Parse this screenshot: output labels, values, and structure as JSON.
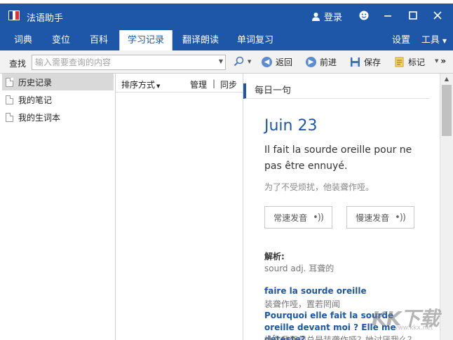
{
  "app": {
    "title": "法语助手",
    "user_label": "登录",
    "logo_colors": [
      "#1e3f9a",
      "#ffffff",
      "#e8312f"
    ]
  },
  "window_controls": {
    "smiley_icon": "smiley-icon",
    "minimize_icon": "minimize-icon",
    "maximize_icon": "maximize-icon",
    "close_icon": "close-icon"
  },
  "nav": {
    "tabs": [
      {
        "label": "词典",
        "active": false
      },
      {
        "label": "变位",
        "active": false
      },
      {
        "label": "百科",
        "active": false
      },
      {
        "label": "学习记录",
        "active": true
      },
      {
        "label": "翻译朗读",
        "active": false
      },
      {
        "label": "单词复习",
        "active": false
      }
    ],
    "settings_label": "设置",
    "tools_label": "工具"
  },
  "toolbar": {
    "search_label": "查找",
    "search_placeholder": "输入需要查询的内容",
    "back_label": "返回",
    "forward_label": "前进",
    "save_label": "保存",
    "bookmark_label": "标记"
  },
  "sidebar": {
    "items": [
      {
        "label": "历史记录",
        "selected": true
      },
      {
        "label": "我的笔记",
        "selected": false
      },
      {
        "label": "我的生词本",
        "selected": false
      }
    ]
  },
  "list_header": {
    "sort_label": "排序方式",
    "manage_label": "管理",
    "separator": "|",
    "sync_label": "同步"
  },
  "daily": {
    "header": "每日一句",
    "date": "Juin 23",
    "sentence_fr": "Il fait la sourde oreille pour ne pas être ennuyé.",
    "sentence_cn": "为了不受烦扰，他装聋作哑。",
    "normal_speed_label": "常速发音",
    "slow_speed_label": "慢速发音",
    "analysis_label": "解析:",
    "analysis_text": "sourd adj. 耳聋的",
    "examples": [
      {
        "fr": "faire la sourde oreille",
        "cn": "装聋作哑，置若罔闻"
      },
      {
        "fr": "Pourquoi elle fait la sourde oreille devant moi ? Elle me déteste?",
        "cn": "她在我面前总是装聋作哑？她讨厌我么？"
      }
    ]
  },
  "watermark": {
    "text": "KK下载",
    "sub": "www.kkx.net"
  },
  "colors": {
    "brand_blue": "#1e57a7",
    "tab_active_bg": "#ffffff",
    "sidebar_selected": "#d9d9d9"
  }
}
